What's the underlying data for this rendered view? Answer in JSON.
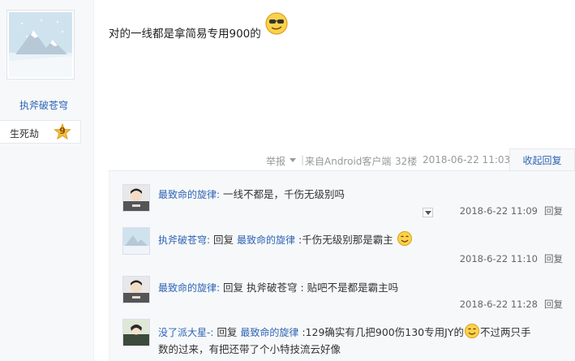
{
  "author": {
    "name": "执斧破苍穹",
    "level_name": "生死劫",
    "level": "9"
  },
  "post": {
    "text": "对的一线都是拿简易专用900的",
    "emoji": "cool-sunglasses-emoji"
  },
  "tail": {
    "report": "举报",
    "separator": "|",
    "from": "来自Android客户端",
    "floor": "32楼",
    "time": "2018-06-22 11:03",
    "collapse": "收起回复"
  },
  "replies": [
    {
      "user": "最致命的旋律:",
      "text": "一线不都是，千伤无级别吗",
      "time": "2018-6-22 11:09",
      "reply_label": "回复"
    },
    {
      "user": "执斧破苍穹:",
      "prefix": "回复 ",
      "target": "最致命的旋律",
      "text": " :千伤无级别那是霸主",
      "time": "2018-6-22 11:10",
      "reply_label": "回复"
    },
    {
      "user": "最致命的旋律:",
      "prefix": "回复 执斧破苍穹 ",
      "text": ": 贴吧不是都是霸主吗",
      "time": "2018-6-22 11:28",
      "reply_label": "回复"
    },
    {
      "user": "没了派大星-:",
      "prefix": "回复 ",
      "target": "最致命的旋律",
      "text": " :129确实有几把900伤130专用JY的",
      "text_after": "不过两只手",
      "text_line2": "数的过来，有把还带了个小特技流云好像"
    }
  ],
  "colors": {
    "link": "#2d64b3",
    "panel_bg": "#f7f8fa"
  }
}
